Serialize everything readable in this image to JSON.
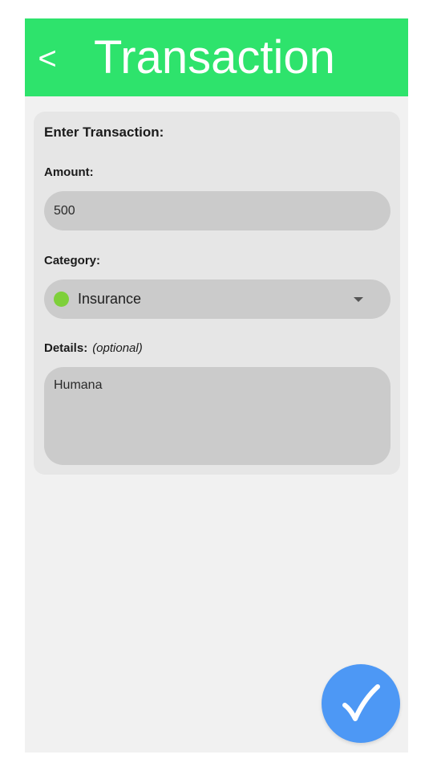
{
  "header": {
    "back_label": "<",
    "title": "Transaction",
    "color": "#2ee36c"
  },
  "form": {
    "title": "Enter Transaction:",
    "amount": {
      "label": "Amount:",
      "value": "500"
    },
    "category": {
      "label": "Category:",
      "selected": "Insurance",
      "dot_color": "#7ed03a"
    },
    "details": {
      "label": "Details:",
      "hint": "(optional)",
      "value": "Humana"
    }
  },
  "fab": {
    "icon": "checkmark-icon",
    "color": "#4d98f5"
  }
}
